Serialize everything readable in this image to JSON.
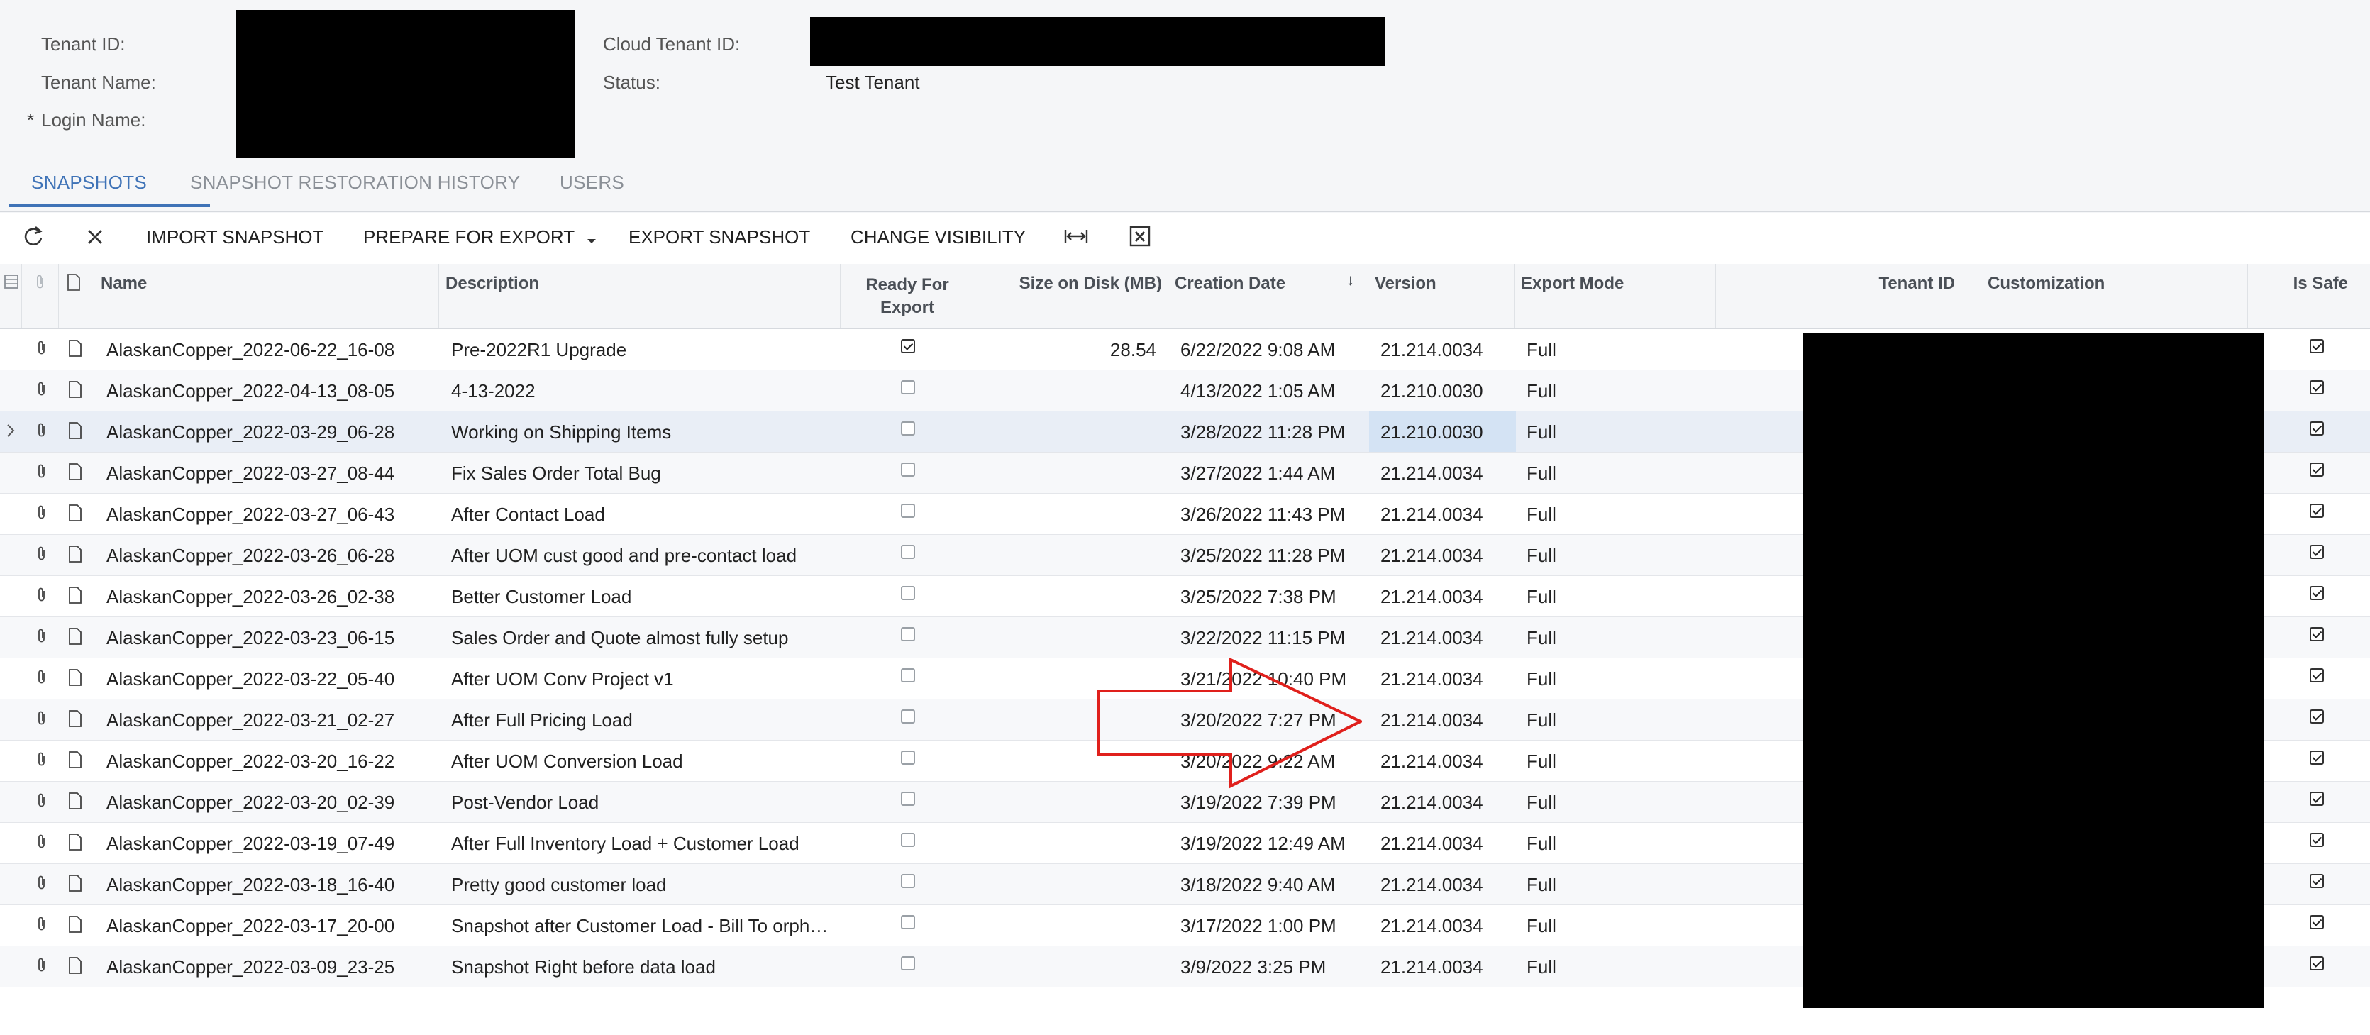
{
  "header": {
    "tenant_id_label": "Tenant ID:",
    "tenant_name_label": "Tenant Name:",
    "login_name_required": "*",
    "login_name_label": "Login Name:",
    "cloud_tenant_id_label": "Cloud Tenant ID:",
    "status_label": "Status:",
    "status_value": "Test Tenant"
  },
  "tabs": [
    {
      "label": "SNAPSHOTS",
      "active": true
    },
    {
      "label": "SNAPSHOT RESTORATION HISTORY",
      "active": false
    },
    {
      "label": "USERS",
      "active": false
    }
  ],
  "toolbar": {
    "refresh_icon": "refresh-icon",
    "discard_icon": "close-icon",
    "import_label": "IMPORT SNAPSHOT",
    "prepare_label": "PREPARE FOR EXPORT",
    "export_label": "EXPORT SNAPSHOT",
    "visibility_label": "CHANGE VISIBILITY",
    "fit_icon": "fit-columns-icon",
    "excel_icon": "excel-export-icon"
  },
  "grid": {
    "columns": {
      "name": "Name",
      "description": "Description",
      "ready_line1": "Ready For",
      "ready_line2": "Export",
      "size": "Size on Disk (MB)",
      "created": "Creation Date",
      "sort_indicator": "↓",
      "version": "Version",
      "export_mode": "Export Mode",
      "tenant_id": "Tenant ID",
      "customization": "Customization",
      "is_safe": "Is Safe"
    },
    "rows": [
      {
        "name": "AlaskanCopper_2022-06-22_16-08",
        "description": "Pre-2022R1 Upgrade",
        "ready": true,
        "size": "28.54",
        "created": "6/22/2022 9:08 AM",
        "version": "21.214.0034",
        "mode": "Full",
        "safe": true
      },
      {
        "name": "AlaskanCopper_2022-04-13_08-05",
        "description": "4-13-2022",
        "ready": false,
        "size": "",
        "created": "4/13/2022 1:05 AM",
        "version": "21.210.0030",
        "mode": "Full",
        "safe": true
      },
      {
        "name": "AlaskanCopper_2022-03-29_06-28",
        "description": "Working on Shipping Items",
        "ready": false,
        "size": "",
        "created": "3/28/2022 11:28 PM",
        "version": "21.210.0030",
        "mode": "Full",
        "safe": true
      },
      {
        "name": "AlaskanCopper_2022-03-27_08-44",
        "description": "Fix Sales Order Total Bug",
        "ready": false,
        "size": "",
        "created": "3/27/2022 1:44 AM",
        "version": "21.214.0034",
        "mode": "Full",
        "safe": true
      },
      {
        "name": "AlaskanCopper_2022-03-27_06-43",
        "description": "After Contact Load",
        "ready": false,
        "size": "",
        "created": "3/26/2022 11:43 PM",
        "version": "21.214.0034",
        "mode": "Full",
        "safe": true
      },
      {
        "name": "AlaskanCopper_2022-03-26_06-28",
        "description": "After UOM cust good and pre-contact load",
        "ready": false,
        "size": "",
        "created": "3/25/2022 11:28 PM",
        "version": "21.214.0034",
        "mode": "Full",
        "safe": true
      },
      {
        "name": "AlaskanCopper_2022-03-26_02-38",
        "description": "Better Customer Load",
        "ready": false,
        "size": "",
        "created": "3/25/2022 7:38 PM",
        "version": "21.214.0034",
        "mode": "Full",
        "safe": true
      },
      {
        "name": "AlaskanCopper_2022-03-23_06-15",
        "description": "Sales Order and Quote almost fully setup",
        "ready": false,
        "size": "",
        "created": "3/22/2022 11:15 PM",
        "version": "21.214.0034",
        "mode": "Full",
        "safe": true
      },
      {
        "name": "AlaskanCopper_2022-03-22_05-40",
        "description": "After UOM Conv Project v1",
        "ready": false,
        "size": "",
        "created": "3/21/2022 10:40 PM",
        "version": "21.214.0034",
        "mode": "Full",
        "safe": true
      },
      {
        "name": "AlaskanCopper_2022-03-21_02-27",
        "description": "After Full Pricing Load",
        "ready": false,
        "size": "",
        "created": "3/20/2022 7:27 PM",
        "version": "21.214.0034",
        "mode": "Full",
        "safe": true
      },
      {
        "name": "AlaskanCopper_2022-03-20_16-22",
        "description": "After UOM Conversion Load",
        "ready": false,
        "size": "",
        "created": "3/20/2022 9:22 AM",
        "version": "21.214.0034",
        "mode": "Full",
        "safe": true
      },
      {
        "name": "AlaskanCopper_2022-03-20_02-39",
        "description": "Post-Vendor Load",
        "ready": false,
        "size": "",
        "created": "3/19/2022 7:39 PM",
        "version": "21.214.0034",
        "mode": "Full",
        "safe": true
      },
      {
        "name": "AlaskanCopper_2022-03-19_07-49",
        "description": "After Full Inventory Load + Customer Load",
        "ready": false,
        "size": "",
        "created": "3/19/2022 12:49 AM",
        "version": "21.214.0034",
        "mode": "Full",
        "safe": true
      },
      {
        "name": "AlaskanCopper_2022-03-18_16-40",
        "description": "Pretty good customer load",
        "ready": false,
        "size": "",
        "created": "3/18/2022 9:40 AM",
        "version": "21.214.0034",
        "mode": "Full",
        "safe": true
      },
      {
        "name": "AlaskanCopper_2022-03-17_20-00",
        "description": "Snapshot after Customer Load - Bill To orph…",
        "ready": false,
        "size": "",
        "created": "3/17/2022 1:00 PM",
        "version": "21.214.0034",
        "mode": "Full",
        "safe": true
      },
      {
        "name": "AlaskanCopper_2022-03-09_23-25",
        "description": "Snapshot Right before data load",
        "ready": false,
        "size": "",
        "created": "3/9/2022 3:25 PM",
        "version": "21.214.0034",
        "mode": "Full",
        "safe": true
      }
    ],
    "selected_row": 2
  },
  "annotation": {
    "arrow_color": "#e0201c",
    "points_at": "Version"
  },
  "colors": {
    "accent": "#3f73b7",
    "header_bg": "#f5f6f8",
    "selected_row": "#e9eef6"
  }
}
